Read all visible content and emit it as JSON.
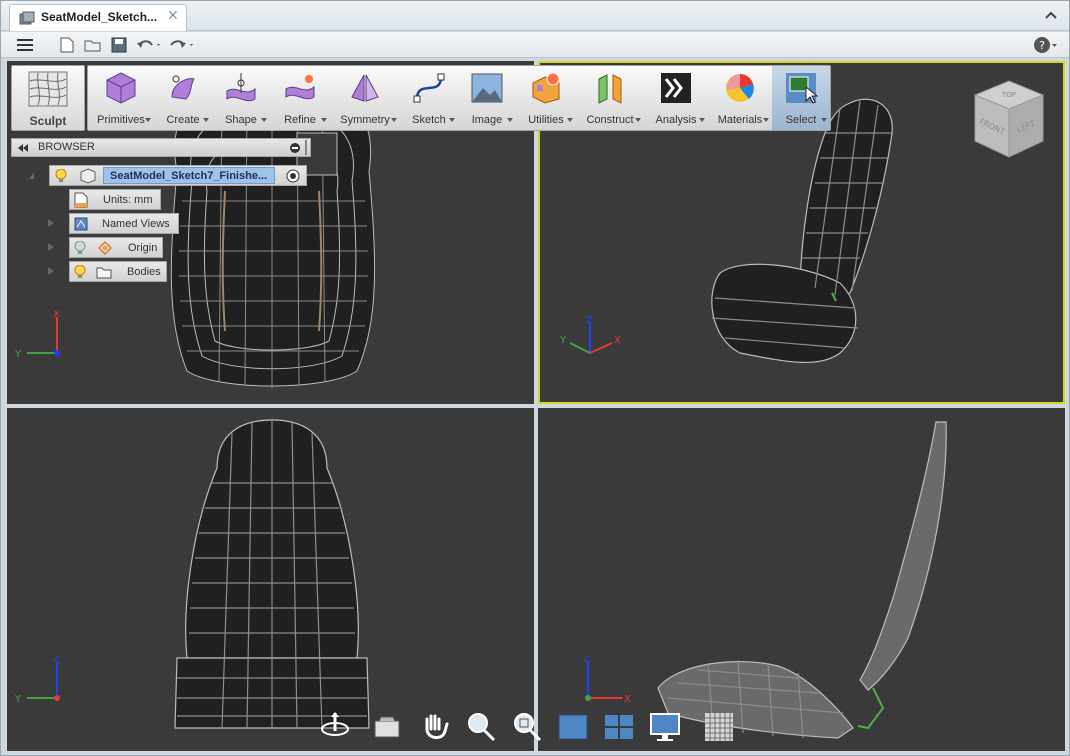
{
  "app": {
    "document_title": "SeatModel_Sketch...",
    "icons": {
      "document": "document-icon",
      "close": "close-icon",
      "collapse": "chevron-up-icon"
    }
  },
  "quick_access": {
    "items": [
      "menu-icon",
      "new-icon",
      "open-icon",
      "save-icon",
      "undo-icon",
      "redo-icon"
    ],
    "help": "help-icon"
  },
  "ribbon": {
    "workspace": "Sculpt",
    "groups": [
      {
        "label": "Primitives",
        "icon": "box-icon"
      },
      {
        "label": "Create",
        "icon": "create-icon"
      },
      {
        "label": "Shape",
        "icon": "shape-icon"
      },
      {
        "label": "Refine",
        "icon": "refine-icon"
      },
      {
        "label": "Symmetry",
        "icon": "symmetry-icon"
      },
      {
        "label": "Sketch",
        "icon": "sketch-curve-icon"
      },
      {
        "label": "Image",
        "icon": "image-icon"
      },
      {
        "label": "Utilities",
        "icon": "utilities-icon"
      },
      {
        "label": "Construct",
        "icon": "construct-icon"
      },
      {
        "label": "Analysis",
        "icon": "analysis-icon"
      },
      {
        "label": "Materials",
        "icon": "materials-icon"
      },
      {
        "label": "Select",
        "icon": "select-icon"
      }
    ]
  },
  "browser": {
    "title": "BROWSER",
    "root": "SeatModel_Sketch7_Finishe...",
    "units": "Units: mm",
    "named_views": "Named Views",
    "origin": "Origin",
    "bodies": "Bodies"
  },
  "viewcube": {
    "top": "TOP",
    "front": "FRONT",
    "left": "LEFT"
  },
  "axes": {
    "x": "X",
    "y": "Y",
    "z": "Z"
  },
  "colors": {
    "viewport_bg": "#3a3a3a",
    "active_viewport_border": "#d6d61a",
    "wire": "#bdbdbd",
    "accent_green": "#4caf50"
  },
  "navbar": [
    "orbit-icon",
    "look-at-icon",
    "pan-icon",
    "zoom-icon",
    "zoom-window-icon",
    "display-mode-icon",
    "viewports-icon",
    "environment-icon",
    "grid-icon"
  ]
}
